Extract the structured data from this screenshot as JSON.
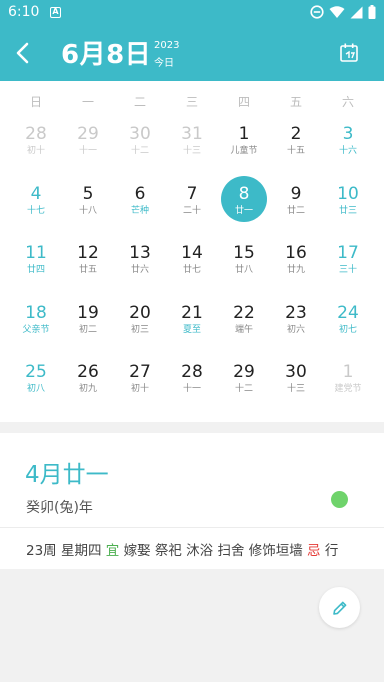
{
  "status_bar": {
    "time": "6:10",
    "notification_glyph": "A",
    "icons": [
      "do-not-disturb-icon",
      "wifi-icon",
      "cellular-icon",
      "battery-icon"
    ]
  },
  "header": {
    "title": "6月8日",
    "year": "2023",
    "today_label": "今日"
  },
  "weekdays": [
    "日",
    "一",
    "二",
    "三",
    "四",
    "五",
    "六"
  ],
  "weeks": [
    [
      {
        "day": "28",
        "lunar": "初十",
        "state": "dim"
      },
      {
        "day": "29",
        "lunar": "十一",
        "state": "dim"
      },
      {
        "day": "30",
        "lunar": "十二",
        "state": "dim"
      },
      {
        "day": "31",
        "lunar": "十三",
        "state": "dim"
      },
      {
        "day": "1",
        "lunar": "儿童节",
        "state": "normal"
      },
      {
        "day": "2",
        "lunar": "十五",
        "state": "normal"
      },
      {
        "day": "3",
        "lunar": "十六",
        "state": "weekend"
      }
    ],
    [
      {
        "day": "4",
        "lunar": "十七",
        "state": "weekend"
      },
      {
        "day": "5",
        "lunar": "十八",
        "state": "normal"
      },
      {
        "day": "6",
        "lunar": "芒种",
        "state": "festival"
      },
      {
        "day": "7",
        "lunar": "二十",
        "state": "normal"
      },
      {
        "day": "8",
        "lunar": "廿一",
        "state": "selected"
      },
      {
        "day": "9",
        "lunar": "廿二",
        "state": "normal"
      },
      {
        "day": "10",
        "lunar": "廿三",
        "state": "weekend"
      }
    ],
    [
      {
        "day": "11",
        "lunar": "廿四",
        "state": "weekend"
      },
      {
        "day": "12",
        "lunar": "廿五",
        "state": "normal"
      },
      {
        "day": "13",
        "lunar": "廿六",
        "state": "normal"
      },
      {
        "day": "14",
        "lunar": "廿七",
        "state": "normal"
      },
      {
        "day": "15",
        "lunar": "廿八",
        "state": "normal"
      },
      {
        "day": "16",
        "lunar": "廿九",
        "state": "normal"
      },
      {
        "day": "17",
        "lunar": "三十",
        "state": "weekend"
      }
    ],
    [
      {
        "day": "18",
        "lunar": "父亲节",
        "state": "weekend"
      },
      {
        "day": "19",
        "lunar": "初二",
        "state": "normal"
      },
      {
        "day": "20",
        "lunar": "初三",
        "state": "normal"
      },
      {
        "day": "21",
        "lunar": "夏至",
        "state": "festival"
      },
      {
        "day": "22",
        "lunar": "端午",
        "state": "normal"
      },
      {
        "day": "23",
        "lunar": "初六",
        "state": "normal"
      },
      {
        "day": "24",
        "lunar": "初七",
        "state": "weekend"
      }
    ],
    [
      {
        "day": "25",
        "lunar": "初八",
        "state": "weekend"
      },
      {
        "day": "26",
        "lunar": "初九",
        "state": "normal"
      },
      {
        "day": "27",
        "lunar": "初十",
        "state": "normal"
      },
      {
        "day": "28",
        "lunar": "十一",
        "state": "normal"
      },
      {
        "day": "29",
        "lunar": "十二",
        "state": "normal"
      },
      {
        "day": "30",
        "lunar": "十三",
        "state": "normal"
      },
      {
        "day": "1",
        "lunar": "建党节",
        "state": "dim"
      }
    ]
  ],
  "detail": {
    "lunar_date": "4月廿一",
    "ganzhi_year": "癸卯(兔)年",
    "week_info": "23周 星期四",
    "yi_label": "宜",
    "yi_items": "嫁娶 祭祀 沐浴 扫舍 修饰垣墙",
    "ji_label": "忌",
    "ji_items": "行"
  },
  "colors": {
    "accent": "#3dbac8",
    "good_dot": "#6fd36b",
    "yi": "#4caf50",
    "ji": "#e53935"
  }
}
